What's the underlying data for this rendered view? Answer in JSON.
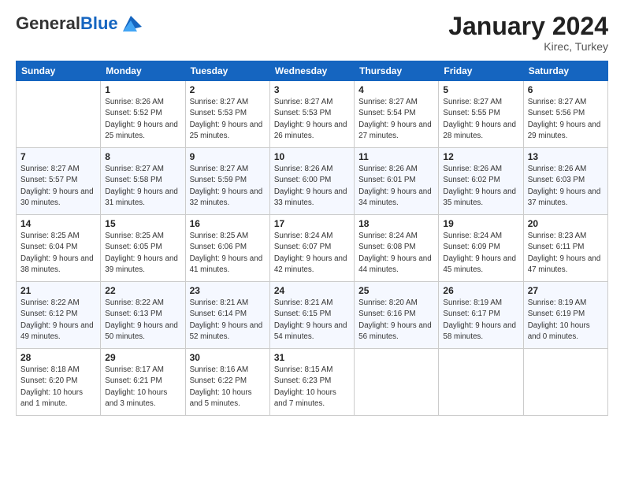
{
  "logo": {
    "general": "General",
    "blue": "Blue"
  },
  "header": {
    "title": "January 2024",
    "subtitle": "Kirec, Turkey"
  },
  "columns": [
    "Sunday",
    "Monday",
    "Tuesday",
    "Wednesday",
    "Thursday",
    "Friday",
    "Saturday"
  ],
  "weeks": [
    [
      {
        "day": "",
        "sunrise": "",
        "sunset": "",
        "daylight": ""
      },
      {
        "day": "1",
        "sunrise": "Sunrise: 8:26 AM",
        "sunset": "Sunset: 5:52 PM",
        "daylight": "Daylight: 9 hours and 25 minutes."
      },
      {
        "day": "2",
        "sunrise": "Sunrise: 8:27 AM",
        "sunset": "Sunset: 5:53 PM",
        "daylight": "Daylight: 9 hours and 25 minutes."
      },
      {
        "day": "3",
        "sunrise": "Sunrise: 8:27 AM",
        "sunset": "Sunset: 5:53 PM",
        "daylight": "Daylight: 9 hours and 26 minutes."
      },
      {
        "day": "4",
        "sunrise": "Sunrise: 8:27 AM",
        "sunset": "Sunset: 5:54 PM",
        "daylight": "Daylight: 9 hours and 27 minutes."
      },
      {
        "day": "5",
        "sunrise": "Sunrise: 8:27 AM",
        "sunset": "Sunset: 5:55 PM",
        "daylight": "Daylight: 9 hours and 28 minutes."
      },
      {
        "day": "6",
        "sunrise": "Sunrise: 8:27 AM",
        "sunset": "Sunset: 5:56 PM",
        "daylight": "Daylight: 9 hours and 29 minutes."
      }
    ],
    [
      {
        "day": "7",
        "sunrise": "Sunrise: 8:27 AM",
        "sunset": "Sunset: 5:57 PM",
        "daylight": "Daylight: 9 hours and 30 minutes."
      },
      {
        "day": "8",
        "sunrise": "Sunrise: 8:27 AM",
        "sunset": "Sunset: 5:58 PM",
        "daylight": "Daylight: 9 hours and 31 minutes."
      },
      {
        "day": "9",
        "sunrise": "Sunrise: 8:27 AM",
        "sunset": "Sunset: 5:59 PM",
        "daylight": "Daylight: 9 hours and 32 minutes."
      },
      {
        "day": "10",
        "sunrise": "Sunrise: 8:26 AM",
        "sunset": "Sunset: 6:00 PM",
        "daylight": "Daylight: 9 hours and 33 minutes."
      },
      {
        "day": "11",
        "sunrise": "Sunrise: 8:26 AM",
        "sunset": "Sunset: 6:01 PM",
        "daylight": "Daylight: 9 hours and 34 minutes."
      },
      {
        "day": "12",
        "sunrise": "Sunrise: 8:26 AM",
        "sunset": "Sunset: 6:02 PM",
        "daylight": "Daylight: 9 hours and 35 minutes."
      },
      {
        "day": "13",
        "sunrise": "Sunrise: 8:26 AM",
        "sunset": "Sunset: 6:03 PM",
        "daylight": "Daylight: 9 hours and 37 minutes."
      }
    ],
    [
      {
        "day": "14",
        "sunrise": "Sunrise: 8:25 AM",
        "sunset": "Sunset: 6:04 PM",
        "daylight": "Daylight: 9 hours and 38 minutes."
      },
      {
        "day": "15",
        "sunrise": "Sunrise: 8:25 AM",
        "sunset": "Sunset: 6:05 PM",
        "daylight": "Daylight: 9 hours and 39 minutes."
      },
      {
        "day": "16",
        "sunrise": "Sunrise: 8:25 AM",
        "sunset": "Sunset: 6:06 PM",
        "daylight": "Daylight: 9 hours and 41 minutes."
      },
      {
        "day": "17",
        "sunrise": "Sunrise: 8:24 AM",
        "sunset": "Sunset: 6:07 PM",
        "daylight": "Daylight: 9 hours and 42 minutes."
      },
      {
        "day": "18",
        "sunrise": "Sunrise: 8:24 AM",
        "sunset": "Sunset: 6:08 PM",
        "daylight": "Daylight: 9 hours and 44 minutes."
      },
      {
        "day": "19",
        "sunrise": "Sunrise: 8:24 AM",
        "sunset": "Sunset: 6:09 PM",
        "daylight": "Daylight: 9 hours and 45 minutes."
      },
      {
        "day": "20",
        "sunrise": "Sunrise: 8:23 AM",
        "sunset": "Sunset: 6:11 PM",
        "daylight": "Daylight: 9 hours and 47 minutes."
      }
    ],
    [
      {
        "day": "21",
        "sunrise": "Sunrise: 8:22 AM",
        "sunset": "Sunset: 6:12 PM",
        "daylight": "Daylight: 9 hours and 49 minutes."
      },
      {
        "day": "22",
        "sunrise": "Sunrise: 8:22 AM",
        "sunset": "Sunset: 6:13 PM",
        "daylight": "Daylight: 9 hours and 50 minutes."
      },
      {
        "day": "23",
        "sunrise": "Sunrise: 8:21 AM",
        "sunset": "Sunset: 6:14 PM",
        "daylight": "Daylight: 9 hours and 52 minutes."
      },
      {
        "day": "24",
        "sunrise": "Sunrise: 8:21 AM",
        "sunset": "Sunset: 6:15 PM",
        "daylight": "Daylight: 9 hours and 54 minutes."
      },
      {
        "day": "25",
        "sunrise": "Sunrise: 8:20 AM",
        "sunset": "Sunset: 6:16 PM",
        "daylight": "Daylight: 9 hours and 56 minutes."
      },
      {
        "day": "26",
        "sunrise": "Sunrise: 8:19 AM",
        "sunset": "Sunset: 6:17 PM",
        "daylight": "Daylight: 9 hours and 58 minutes."
      },
      {
        "day": "27",
        "sunrise": "Sunrise: 8:19 AM",
        "sunset": "Sunset: 6:19 PM",
        "daylight": "Daylight: 10 hours and 0 minutes."
      }
    ],
    [
      {
        "day": "28",
        "sunrise": "Sunrise: 8:18 AM",
        "sunset": "Sunset: 6:20 PM",
        "daylight": "Daylight: 10 hours and 1 minute."
      },
      {
        "day": "29",
        "sunrise": "Sunrise: 8:17 AM",
        "sunset": "Sunset: 6:21 PM",
        "daylight": "Daylight: 10 hours and 3 minutes."
      },
      {
        "day": "30",
        "sunrise": "Sunrise: 8:16 AM",
        "sunset": "Sunset: 6:22 PM",
        "daylight": "Daylight: 10 hours and 5 minutes."
      },
      {
        "day": "31",
        "sunrise": "Sunrise: 8:15 AM",
        "sunset": "Sunset: 6:23 PM",
        "daylight": "Daylight: 10 hours and 7 minutes."
      },
      {
        "day": "",
        "sunrise": "",
        "sunset": "",
        "daylight": ""
      },
      {
        "day": "",
        "sunrise": "",
        "sunset": "",
        "daylight": ""
      },
      {
        "day": "",
        "sunrise": "",
        "sunset": "",
        "daylight": ""
      }
    ]
  ]
}
